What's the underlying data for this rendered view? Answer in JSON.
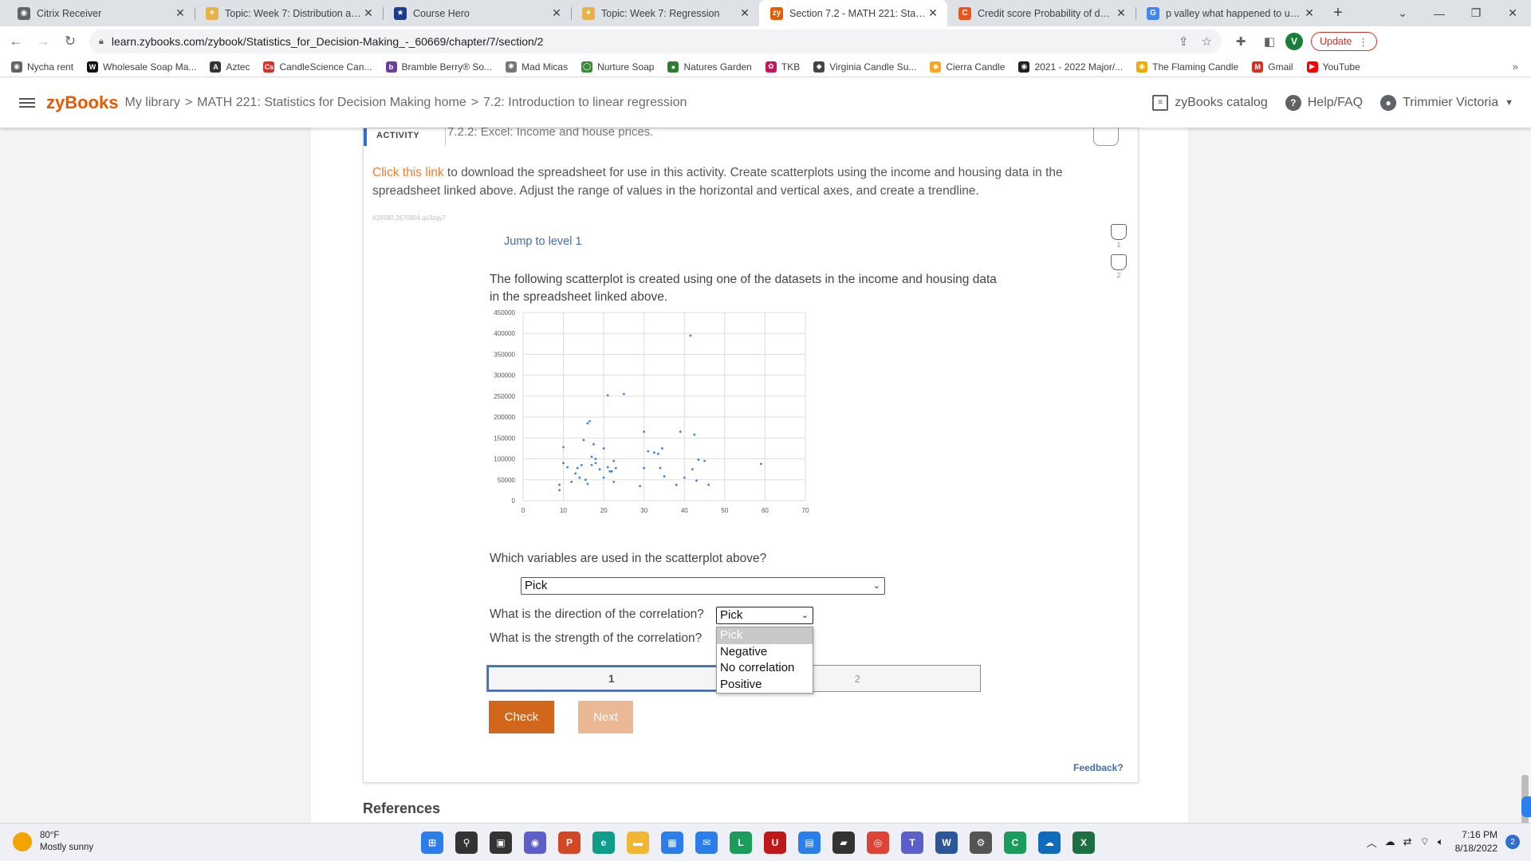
{
  "browser": {
    "tabs": [
      {
        "title": "Citrix Receiver",
        "icon": "citrix-icon",
        "color": "#5f6368",
        "glyph": "◉"
      },
      {
        "title": "Topic: Week 7: Distribution and",
        "icon": "d2l-icon",
        "color": "#e8b24a",
        "glyph": "✦"
      },
      {
        "title": "Course Hero",
        "icon": "coursehero-icon",
        "color": "#1a3b8f",
        "glyph": "★"
      },
      {
        "title": "Topic: Week 7: Regression",
        "icon": "d2l-icon",
        "color": "#e8b24a",
        "glyph": "✦"
      },
      {
        "title": "Section 7.2 - MATH 221: Statistic",
        "icon": "zybooks-icon",
        "color": "#e65a00",
        "glyph": "zy"
      },
      {
        "title": "Credit score Probability of defau",
        "icon": "chegg-icon",
        "color": "#e8561b",
        "glyph": "C"
      },
      {
        "title": "p valley what happened to uncle",
        "icon": "google-icon",
        "color": "#4285f4",
        "glyph": "G"
      }
    ],
    "active_tab": 4,
    "new_tab": "+",
    "url": "learn.zybooks.com/zybook/Statistics_for_Decision-Making_-_60669/chapter/7/section/2",
    "profile_initial": "V",
    "update_label": "Update",
    "bookmarks": [
      {
        "label": "Nycha rent",
        "color": "#5f6368",
        "glyph": "◉"
      },
      {
        "label": "Wholesale Soap Ma...",
        "color": "#111111",
        "glyph": "W"
      },
      {
        "label": "Aztec",
        "color": "#333333",
        "glyph": "A"
      },
      {
        "label": "CandleScience Can...",
        "color": "#d93025",
        "glyph": "Cs"
      },
      {
        "label": "Bramble Berry® So...",
        "color": "#6a3fa0",
        "glyph": "b"
      },
      {
        "label": "Mad Micas",
        "color": "#777777",
        "glyph": "✱"
      },
      {
        "label": "Nurture Soap",
        "color": "#3a8a3a",
        "glyph": "◯"
      },
      {
        "label": "Natures Garden",
        "color": "#2e7d32",
        "glyph": "●"
      },
      {
        "label": "TKB",
        "color": "#c2185b",
        "glyph": "✿"
      },
      {
        "label": "Virginia Candle Su...",
        "color": "#444444",
        "glyph": "◆"
      },
      {
        "label": "Cierra Candle",
        "color": "#f9a825",
        "glyph": "◆"
      },
      {
        "label": "2021 - 2022 Major/...",
        "color": "#202124",
        "glyph": "◉"
      },
      {
        "label": "The Flaming Candle",
        "color": "#f2a900",
        "glyph": "◉"
      },
      {
        "label": "Gmail",
        "color": "#d93025",
        "glyph": "M"
      },
      {
        "label": "YouTube",
        "color": "#ff0000",
        "glyph": "▶"
      }
    ],
    "bookmarks_more": "»"
  },
  "zy": {
    "logo": "zyBooks",
    "crumbs": [
      "My library",
      ">",
      "MATH 221: Statistics for Decision Making home",
      ">",
      "7.2: Introduction to linear regression"
    ],
    "catalog": "zyBooks catalog",
    "help": "Help/FAQ",
    "user": "Trimmier Victoria"
  },
  "activity": {
    "label": "ACTIVITY",
    "title": "7.2.2: Excel: Income and house prices.",
    "link_text": "Click this link",
    "instructions_rest": " to download the spreadsheet for use in this activity. Create scatterplots using the income and housing data in the spreadsheet linked above. Adjust the range of values in the horizontal and vertical axes, and create a trendline.",
    "id_code": "416580.2670904.qx3zqy7",
    "jump": "Jump to level 1",
    "levels": [
      "1",
      "2"
    ],
    "question": "The following scatterplot is created using one of the datasets in the income and housing data in the spreadsheet linked above.",
    "q1": "Which variables are used in the scatterplot above?",
    "q1_value": "Pick",
    "q2": "What is the direction of the correlation?",
    "q2_value": "Pick",
    "q3": "What is the strength of the correlation?",
    "dropdown_options": [
      "Pick",
      "Negative",
      "No correlation",
      "Positive"
    ],
    "progress": [
      "1",
      "2"
    ],
    "check": "Check",
    "next": "Next",
    "feedback": "Feedback?"
  },
  "references": "References",
  "chart_data": {
    "type": "scatter",
    "x_ticks": [
      0,
      10,
      20,
      30,
      40,
      50,
      60,
      70
    ],
    "y_ticks": [
      0,
      50000,
      100000,
      150000,
      200000,
      250000,
      300000,
      350000,
      400000,
      450000
    ],
    "xlim": [
      0,
      70
    ],
    "ylim": [
      0,
      450000
    ],
    "grid": true,
    "color": "#3b82e0",
    "points": [
      [
        9,
        25000
      ],
      [
        9,
        38000
      ],
      [
        10,
        90000
      ],
      [
        10,
        128000
      ],
      [
        11,
        80000
      ],
      [
        12,
        45000
      ],
      [
        13,
        65000
      ],
      [
        13.5,
        78000
      ],
      [
        14,
        55000
      ],
      [
        14.5,
        85000
      ],
      [
        15,
        145000
      ],
      [
        15.5,
        50000
      ],
      [
        16,
        40000
      ],
      [
        16,
        185000
      ],
      [
        16.5,
        190000
      ],
      [
        17,
        85000
      ],
      [
        17,
        105000
      ],
      [
        17.5,
        135000
      ],
      [
        18,
        100000
      ],
      [
        18,
        90000
      ],
      [
        19,
        75000
      ],
      [
        20,
        55000
      ],
      [
        20,
        125000
      ],
      [
        21,
        252000
      ],
      [
        21,
        80000
      ],
      [
        21.5,
        70000
      ],
      [
        22,
        70000
      ],
      [
        22.5,
        95000
      ],
      [
        22.5,
        45000
      ],
      [
        23,
        78000
      ],
      [
        25,
        255000
      ],
      [
        29,
        35000
      ],
      [
        30,
        78000
      ],
      [
        30,
        165000
      ],
      [
        31,
        118000
      ],
      [
        32.5,
        115000
      ],
      [
        33.5,
        112000
      ],
      [
        34,
        78000
      ],
      [
        34.5,
        125000
      ],
      [
        35,
        58000
      ],
      [
        38,
        38000
      ],
      [
        39,
        165000
      ],
      [
        40,
        55000
      ],
      [
        41.5,
        395000
      ],
      [
        42,
        75000
      ],
      [
        42.5,
        158000
      ],
      [
        43,
        48000
      ],
      [
        43.5,
        98000
      ],
      [
        45,
        95000
      ],
      [
        46,
        38000
      ],
      [
        59,
        88000
      ]
    ]
  },
  "taskbar": {
    "temp": "80°F",
    "weather": "Mostly sunny",
    "time": "7:16 PM",
    "date": "8/18/2022",
    "notifications": "2",
    "apps": [
      {
        "name": "windows-start-icon",
        "color": "#2b7de9",
        "glyph": "⊞"
      },
      {
        "name": "search-icon",
        "color": "#333333",
        "glyph": "⚲"
      },
      {
        "name": "task-view-icon",
        "color": "#333333",
        "glyph": "▣"
      },
      {
        "name": "chat-icon",
        "color": "#5b5fc7",
        "glyph": "◉"
      },
      {
        "name": "powerpoint-icon",
        "color": "#d24726",
        "glyph": "P"
      },
      {
        "name": "edge-icon",
        "color": "#0f9d8a",
        "glyph": "e"
      },
      {
        "name": "file-explorer-icon",
        "color": "#f2b632",
        "glyph": "▬"
      },
      {
        "name": "store-icon",
        "color": "#2b7de9",
        "glyph": "▦"
      },
      {
        "name": "mail-icon",
        "color": "#2b7de9",
        "glyph": "✉"
      },
      {
        "name": "l-app-icon",
        "color": "#1a9c5a",
        "glyph": "L"
      },
      {
        "name": "mcafee-icon",
        "color": "#c01818",
        "glyph": "U"
      },
      {
        "name": "calculator-icon",
        "color": "#2b7de9",
        "glyph": "▤"
      },
      {
        "name": "media-icon",
        "color": "#333333",
        "glyph": "▰"
      },
      {
        "name": "chrome-icon",
        "color": "#db4437",
        "glyph": "◎"
      },
      {
        "name": "teams-icon",
        "color": "#5b5fc7",
        "glyph": "T"
      },
      {
        "name": "word-icon",
        "color": "#2b579a",
        "glyph": "W"
      },
      {
        "name": "settings-icon",
        "color": "#555555",
        "glyph": "⚙"
      },
      {
        "name": "app-c-icon",
        "color": "#1a9c5a",
        "glyph": "C"
      },
      {
        "name": "onedrive-icon",
        "color": "#0f6cbd",
        "glyph": "☁"
      },
      {
        "name": "excel-icon",
        "color": "#1d6f42",
        "glyph": "X"
      }
    ]
  }
}
